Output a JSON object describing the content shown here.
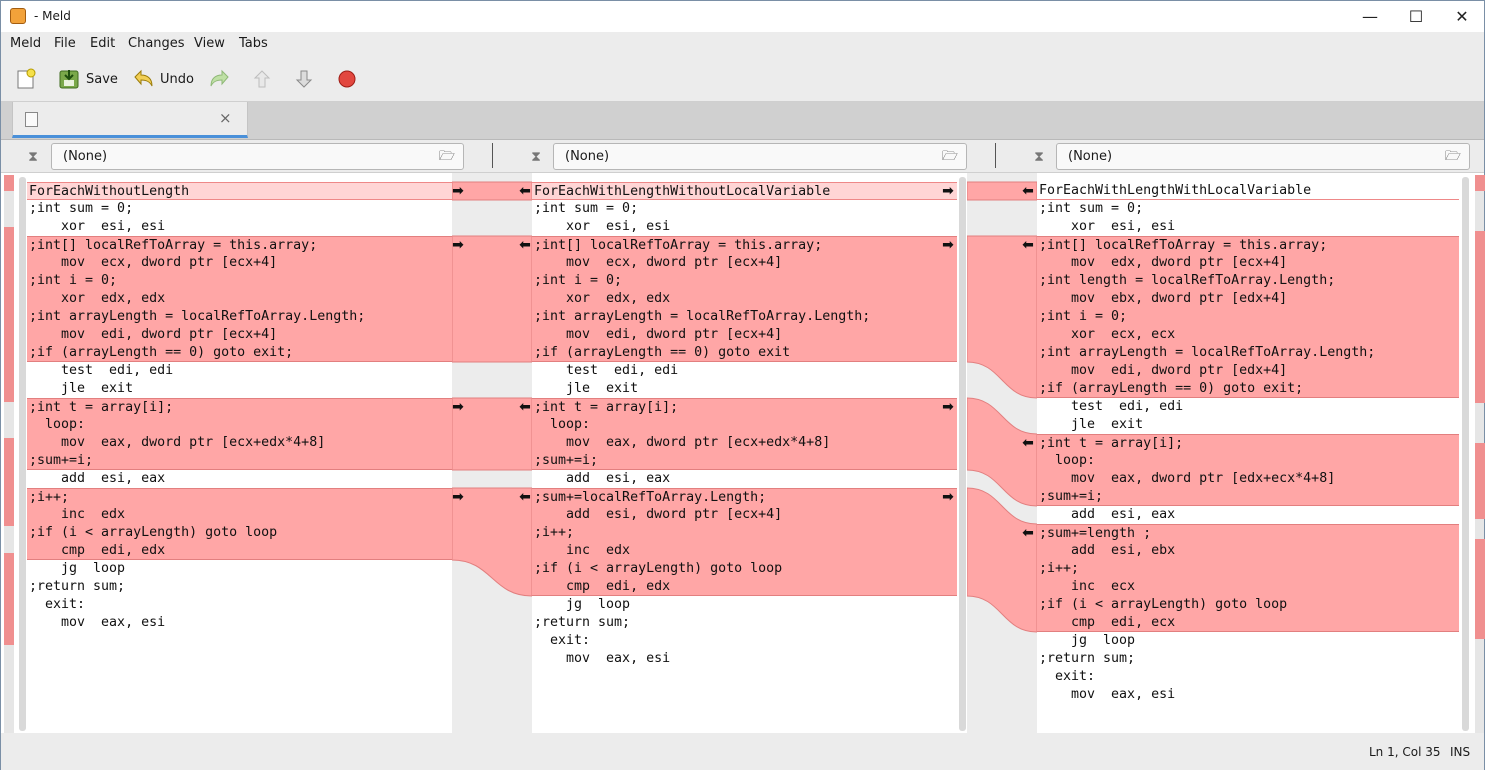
{
  "window": {
    "title": "- Meld",
    "minimize": "—",
    "maximize": "☐",
    "close": "✕"
  },
  "menu": [
    "Meld",
    "File",
    "Edit",
    "Changes",
    "View",
    "Tabs"
  ],
  "toolbar": {
    "save_label": "Save",
    "undo_label": "Undo"
  },
  "tabs": [
    {
      "label": "",
      "close": "×"
    }
  ],
  "panes": [
    {
      "filter_value": "(None)"
    },
    {
      "filter_value": "(None)"
    },
    {
      "filter_value": "(None)"
    }
  ],
  "colors": {
    "change": "#ffa6a6",
    "gutter_mark": "#f08f8f",
    "accent": "#4a90d9"
  },
  "files": [
    {
      "lines": [
        "ForEachWithoutLength",
        ";int sum = 0;",
        "    xor  esi, esi",
        ";int[] localRefToArray = this.array;",
        "    mov  ecx, dword ptr [ecx+4]",
        ";int i = 0;",
        "    xor  edx, edx",
        ";int arrayLength = localRefToArray.Length;",
        "    mov  edi, dword ptr [ecx+4]",
        ";if (arrayLength == 0) goto exit;",
        "    test  edi, edi",
        "    jle  exit",
        ";int t = array[i];",
        "  loop:",
        "    mov  eax, dword ptr [ecx+edx*4+8]",
        ";sum+=i;",
        "    add  esi, eax",
        ";i++;",
        "    inc  edx",
        ";if (i < arrayLength) goto loop",
        "    cmp  edi, edx",
        "    jg  loop",
        ";return sum;",
        "  exit:",
        "    mov  eax, esi"
      ]
    },
    {
      "lines": [
        "ForEachWithLengthWithoutLocalVariable",
        ";int sum = 0;",
        "    xor  esi, esi",
        ";int[] localRefToArray = this.array;",
        "    mov  ecx, dword ptr [ecx+4]",
        ";int i = 0;",
        "    xor  edx, edx",
        ";int arrayLength = localRefToArray.Length;",
        "    mov  edi, dword ptr [ecx+4]",
        ";if (arrayLength == 0) goto exit",
        "    test  edi, edi",
        "    jle  exit",
        ";int t = array[i];",
        "  loop:",
        "    mov  eax, dword ptr [ecx+edx*4+8]",
        ";sum+=i;",
        "    add  esi, eax",
        ";sum+=localRefToArray.Length;",
        "    add  esi, dword ptr [ecx+4]",
        ";i++;",
        "    inc  edx",
        ";if (i < arrayLength) goto loop",
        "    cmp  edi, edx",
        "    jg  loop",
        ";return sum;",
        "  exit:",
        "    mov  eax, esi"
      ]
    },
    {
      "lines": [
        "ForEachWithLengthWithLocalVariable",
        ";int sum = 0;",
        "    xor  esi, esi",
        ";int[] localRefToArray = this.array;",
        "    mov  edx, dword ptr [ecx+4]",
        ";int length = localRefToArray.Length;",
        "    mov  ebx, dword ptr [edx+4]",
        ";int i = 0;",
        "    xor  ecx, ecx",
        ";int arrayLength = localRefToArray.Length;",
        "    mov  edi, dword ptr [edx+4]",
        ";if (arrayLength == 0) goto exit;",
        "    test  edi, edi",
        "    jle  exit",
        ";int t = array[i];",
        "  loop:",
        "    mov  eax, dword ptr [edx+ecx*4+8]",
        ";sum+=i;",
        "    add  esi, eax",
        ";sum+=length ;",
        "    add  esi, ebx",
        ";i++;",
        "    inc  ecx",
        ";if (i < arrayLength) goto loop",
        "    cmp  edi, ecx",
        "    jg  loop",
        ";return sum;",
        "  exit:",
        "    mov  eax, esi"
      ]
    }
  ],
  "status": {
    "position": "Ln 1, Col 35",
    "mode": "INS"
  }
}
